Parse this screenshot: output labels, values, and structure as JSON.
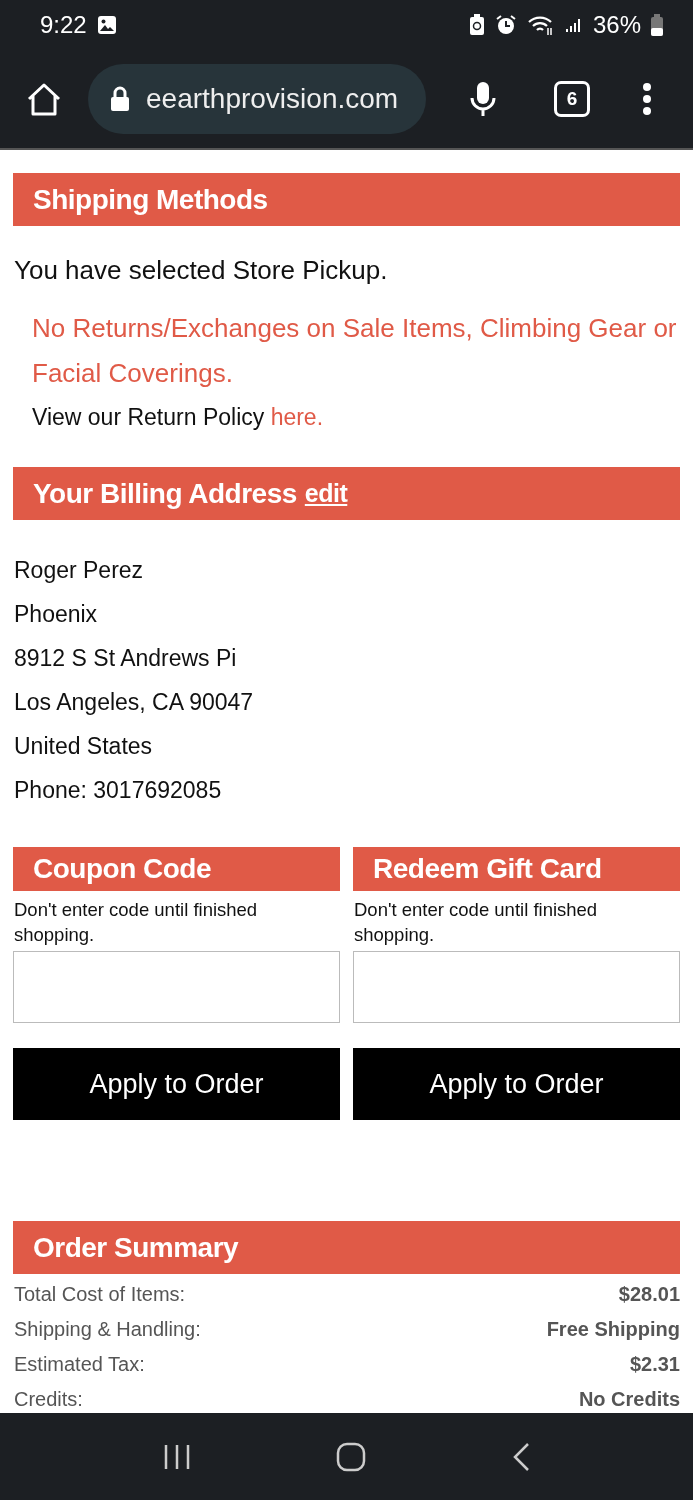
{
  "status_bar": {
    "time": "9:22",
    "battery": "36%"
  },
  "browser": {
    "url": "eearthprovision.com",
    "tab_count": "6"
  },
  "shipping": {
    "title": "Shipping Methods",
    "message": "You have selected Store Pickup.",
    "notice": "No Returns/Exchanges on Sale Items, Climbing Gear or Facial Coverings.",
    "policy_text": "View our Return Policy",
    "policy_link": "here."
  },
  "billing": {
    "title": "Your Billing Address",
    "edit_link": "edit",
    "lines": [
      "Roger Perez",
      "Phoenix",
      "8912 S St Andrews Pi",
      "Los Angeles, CA 90047",
      "United States",
      "Phone: 3017692085"
    ]
  },
  "codes": [
    {
      "title": "Coupon Code",
      "hint": "Don't enter code until finished shopping.",
      "button": "Apply to Order"
    },
    {
      "title": "Redeem Gift Card",
      "hint": "Don't enter code until finished shopping.",
      "button": "Apply to Order"
    }
  ],
  "summary": {
    "title": "Order Summary",
    "rows": [
      {
        "label": "Total Cost of Items:",
        "value": "$28.01"
      },
      {
        "label": "Shipping & Handling:",
        "value": "Free Shipping"
      },
      {
        "label": "Estimated Tax:",
        "value": "$2.31"
      },
      {
        "label": "Credits:",
        "value": "No Credits"
      }
    ]
  }
}
